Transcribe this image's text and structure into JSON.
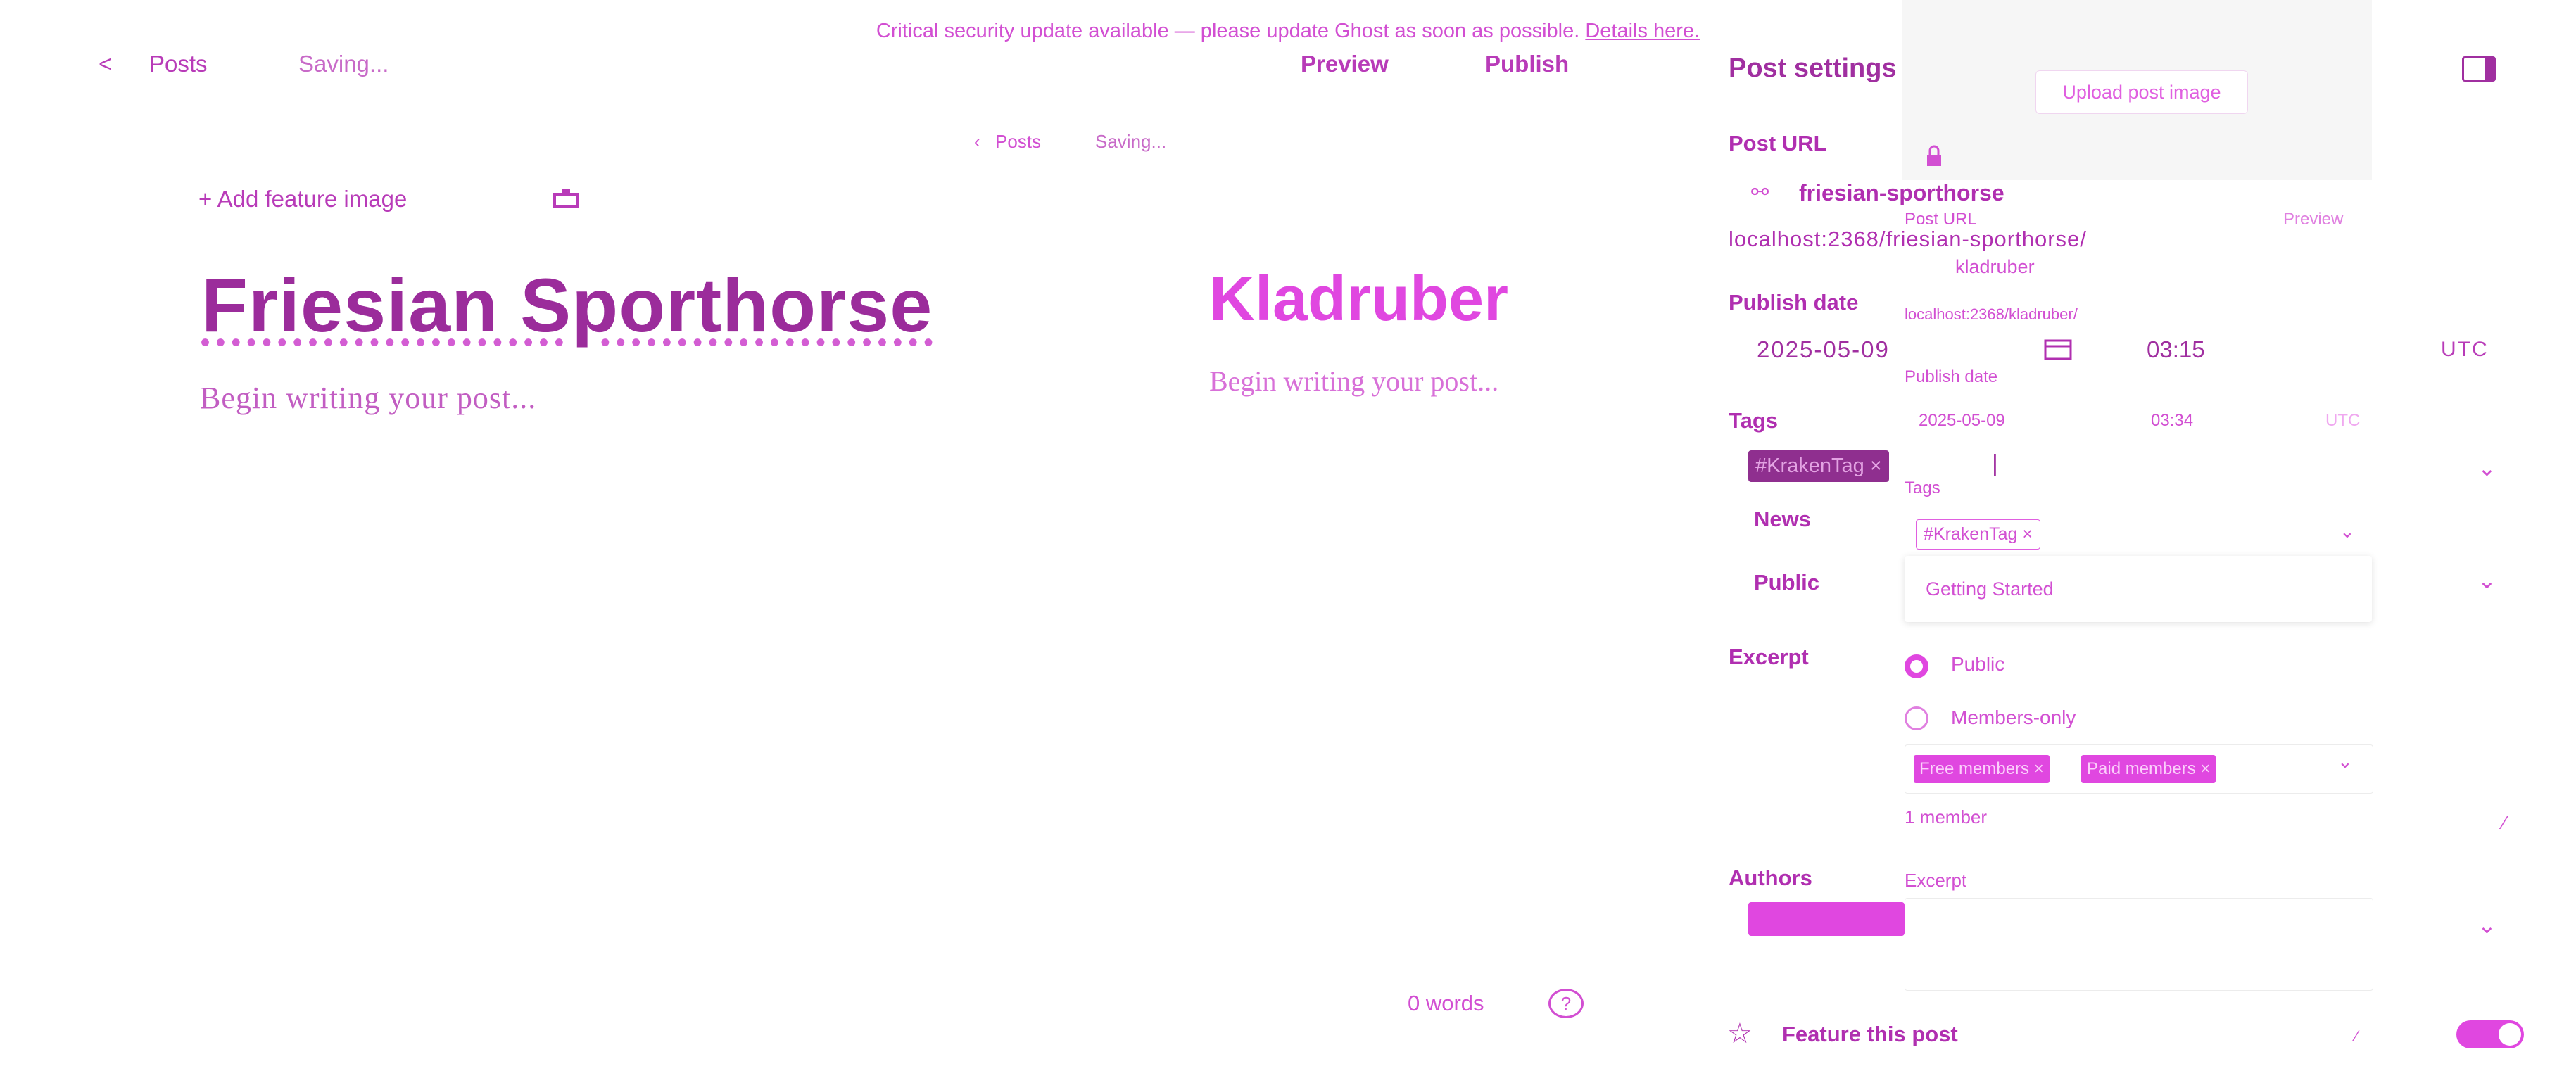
{
  "banner": {
    "text": "Critical security update available — please update Ghost as soon as possible.",
    "link": "Details here."
  },
  "topbar": {
    "back_arrow": "<",
    "posts": "Posts",
    "status": "Saving...",
    "preview": "Preview",
    "publish": "Publish"
  },
  "topbar2": {
    "back_arrow": "‹",
    "posts": "Posts",
    "status": "Saving..."
  },
  "editor": {
    "add_feature_image": "+ Add feature image",
    "title": "Friesian Sporthorse",
    "placeholder": "Begin writing your post..."
  },
  "editor2": {
    "title": "Kladruber",
    "placeholder": "Begin writing your post..."
  },
  "footer": {
    "word_count": "0 words",
    "help": "?"
  },
  "settings": {
    "heading": "Post settings",
    "upload_image": "Upload post image",
    "post_url_label": "Post URL",
    "slug": "friesian-sporthorse",
    "url": "localhost:2368/friesian-sporthorse/",
    "publish_date_label": "Publish date",
    "date": "2025-05-09",
    "time": "03:15",
    "timezone": "UTC",
    "tags_label": "Tags",
    "tag_chip": "#KrakenTag ×",
    "visibility_news": "News",
    "visibility_public": "Public",
    "excerpt_label": "Excerpt",
    "authors_label": "Authors",
    "feature_label": "Feature this post"
  },
  "settings2": {
    "post_url_label": "Post URL",
    "preview": "Preview",
    "slug": "kladruber",
    "url": "localhost:2368/kladruber/",
    "publish_date_label": "Publish date",
    "date": "2025-05-09",
    "time": "03:34",
    "timezone": "UTC",
    "tags_label": "Tags",
    "tag_chip": "#KrakenTag ×",
    "dropdown_option": "Getting Started",
    "radio_public": "Public",
    "radio_members": "Members-only",
    "chip_free": "Free members ×",
    "chip_paid": "Paid members ×",
    "member_count": "1 member",
    "excerpt_label": "Excerpt"
  },
  "colors": {
    "accent": "#e047e0",
    "accent_dark": "#9b2c9b"
  }
}
